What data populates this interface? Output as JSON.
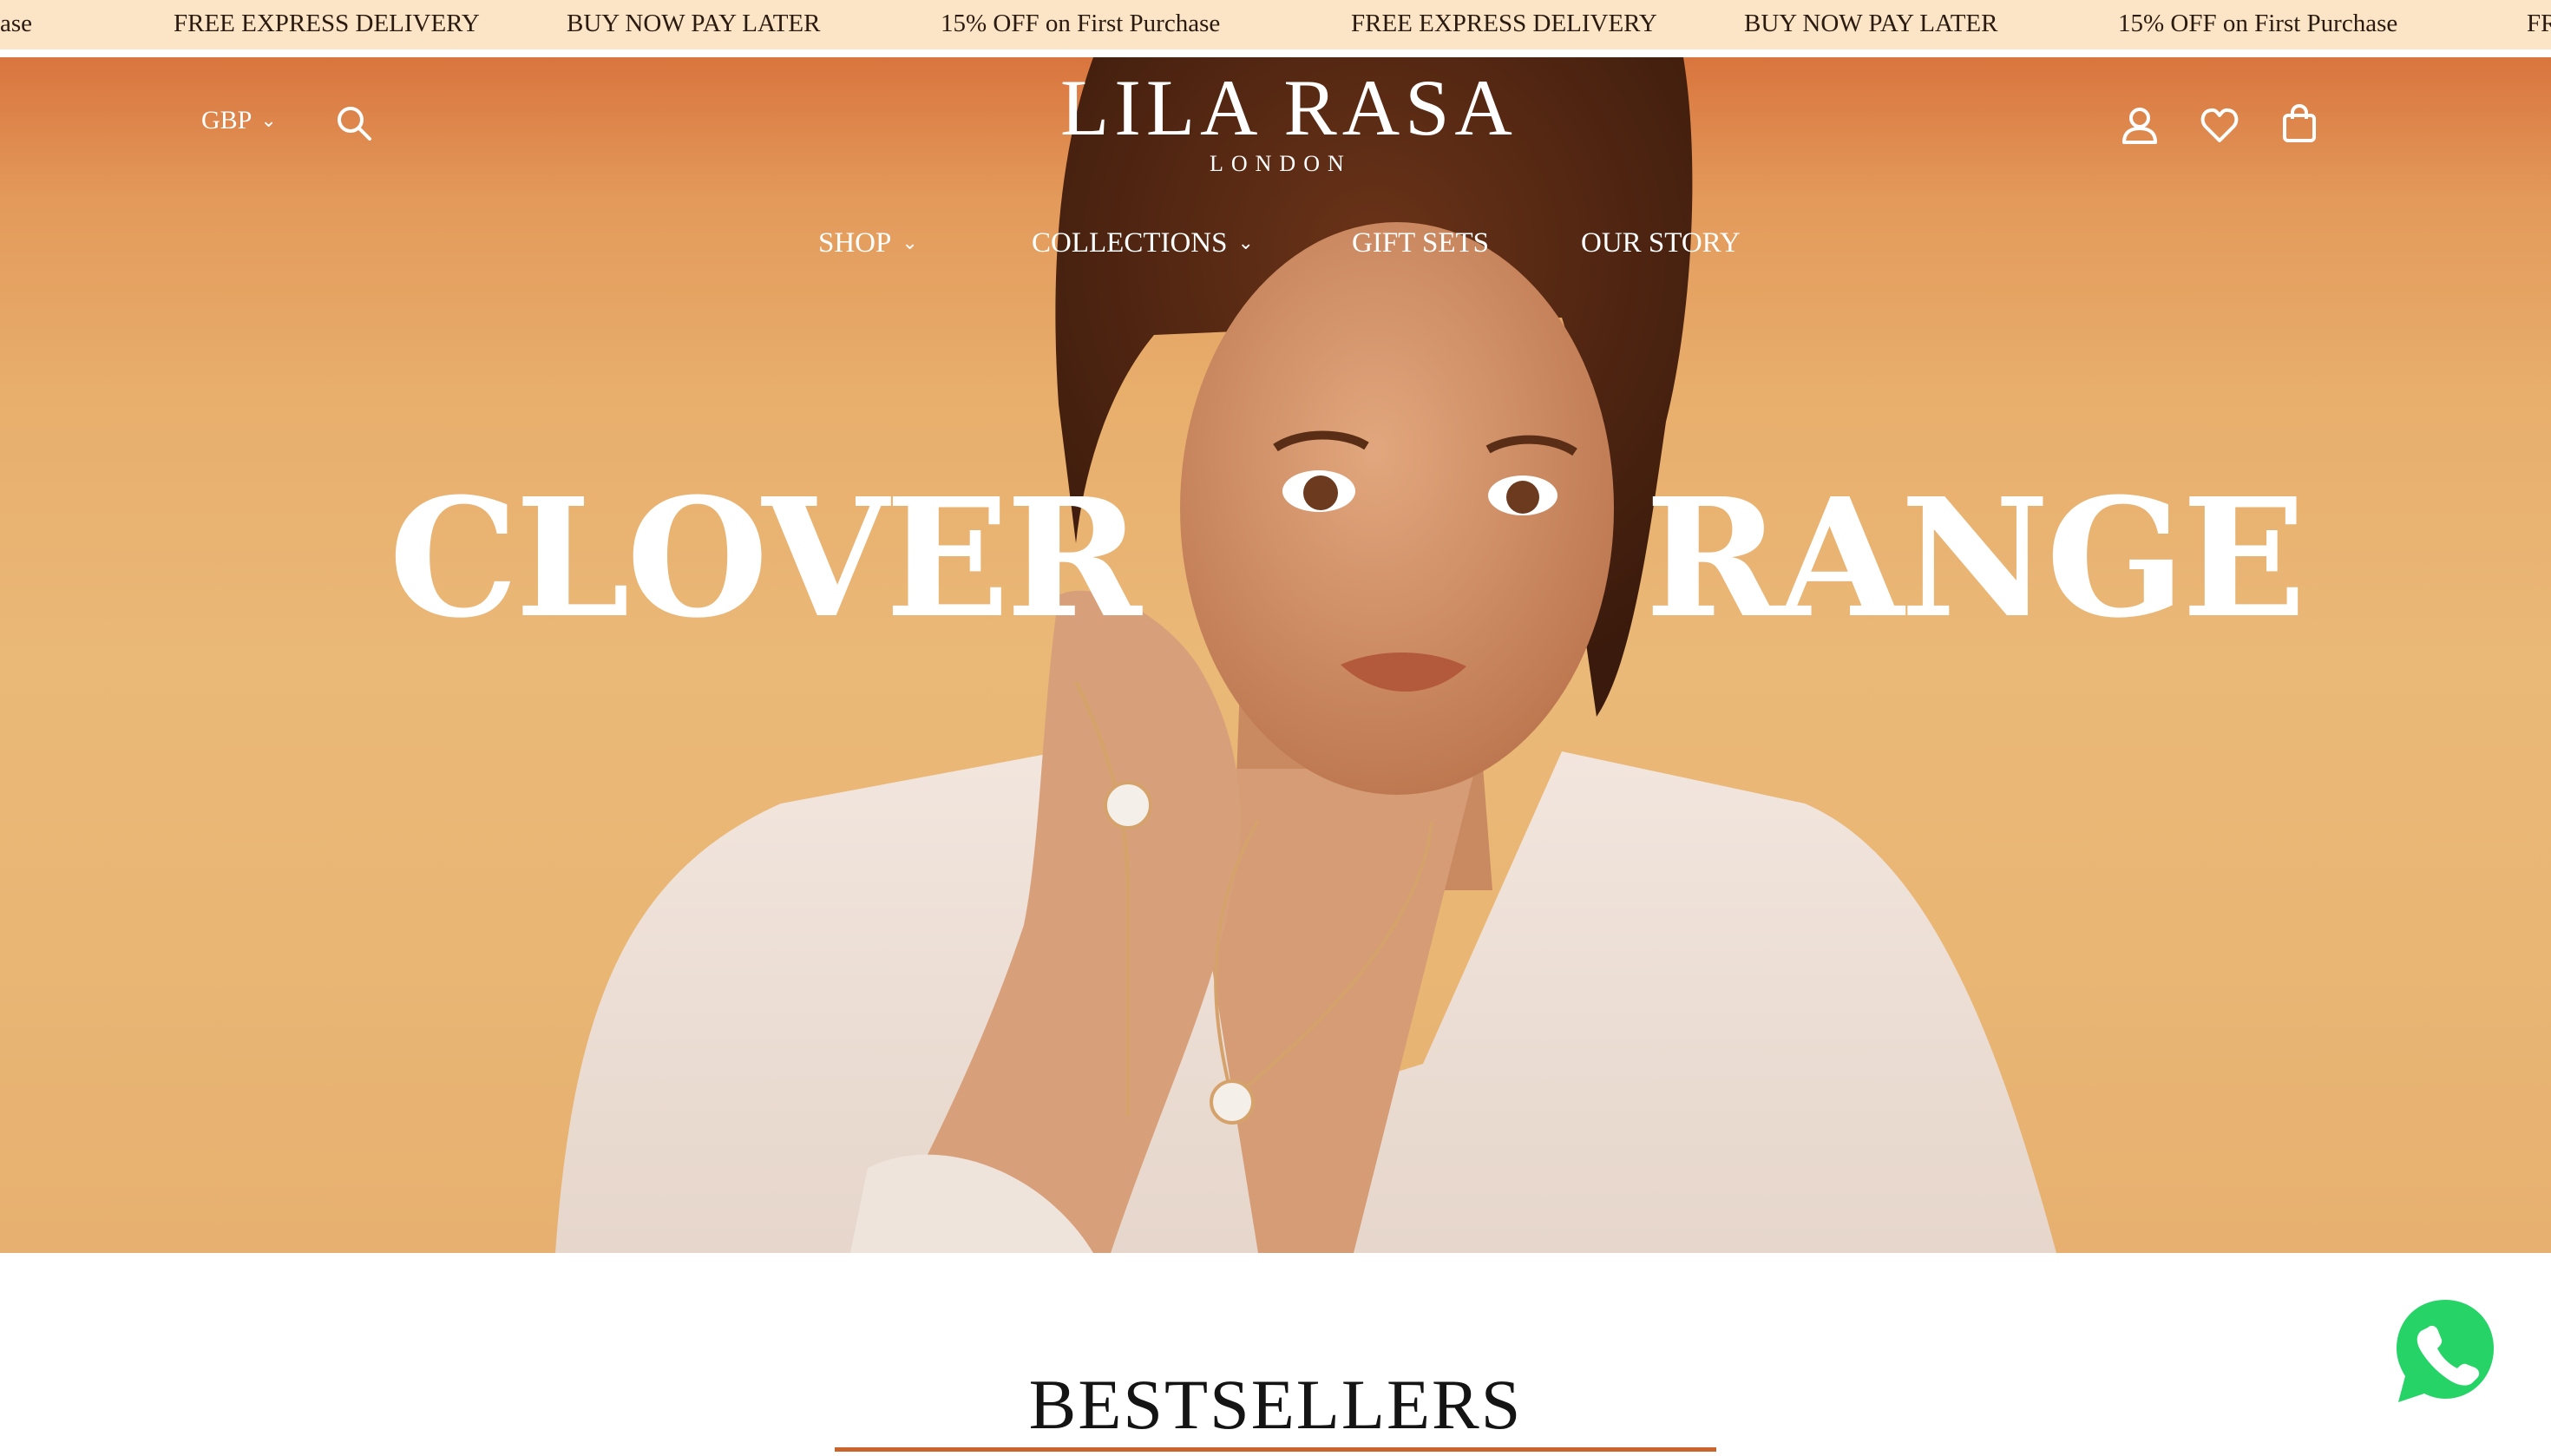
{
  "announcement_bar": {
    "messages": [
      "ase",
      "FREE EXPRESS DELIVERY",
      "BUY NOW PAY LATER",
      "15% OFF on First Purchase",
      "FREE EXPRESS DELIVERY",
      "BUY NOW PAY LATER",
      "15% OFF on First Purchase",
      "FR"
    ]
  },
  "header": {
    "currency": "GBP",
    "brand_name": "LILA RASA",
    "brand_subtitle": "LONDON",
    "icons": [
      "search-icon",
      "account-icon",
      "wishlist-heart-icon",
      "cart-bag-icon"
    ]
  },
  "nav": {
    "items": [
      {
        "label": "SHOP",
        "has_dropdown": true
      },
      {
        "label": "COLLECTIONS",
        "has_dropdown": true
      },
      {
        "label": "GIFT SETS",
        "has_dropdown": false
      },
      {
        "label": "OUR STORY",
        "has_dropdown": false
      }
    ]
  },
  "hero": {
    "headline_left": "CLOVER",
    "headline_right": "RANGE"
  },
  "section": {
    "title": "BESTSELLERS"
  },
  "floating": {
    "chat_icon": "whatsapp-icon"
  },
  "colors": {
    "announcement_bg": "#fbe5c6",
    "hero_top": "#d9753e",
    "hero_mid": "#eab877",
    "accent_rule": "#c9652a",
    "whatsapp_green": "#25d366"
  }
}
